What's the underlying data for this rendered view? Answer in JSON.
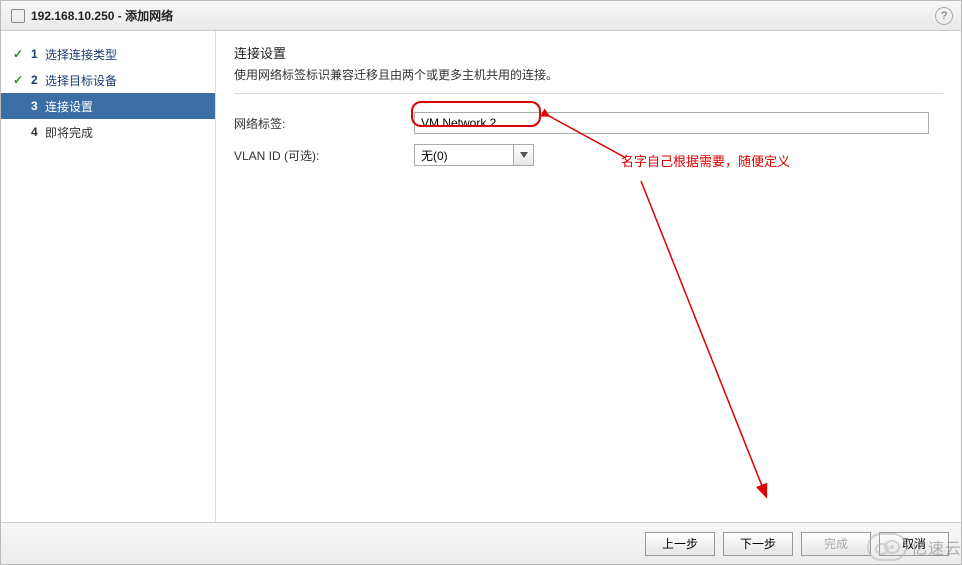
{
  "title": "192.168.10.250 - 添加网络",
  "help_symbol": "?",
  "steps": [
    {
      "num": "1",
      "label": "选择连接类型",
      "state": "done"
    },
    {
      "num": "2",
      "label": "选择目标设备",
      "state": "done"
    },
    {
      "num": "3",
      "label": "连接设置",
      "state": "active"
    },
    {
      "num": "4",
      "label": "即将完成",
      "state": "pending"
    }
  ],
  "section": {
    "title": "连接设置",
    "desc": "使用网络标签标识兼容迁移且由两个或更多主机共用的连接。"
  },
  "form": {
    "network_label": {
      "label": "网络标签:",
      "value": "VM Network 2"
    },
    "vlan": {
      "label": "VLAN ID (可选):",
      "selected": "无(0)"
    }
  },
  "annotation": {
    "text": "名字自己根据需要，随便定义"
  },
  "buttons": {
    "back": "上一步",
    "next": "下一步",
    "finish": "完成",
    "cancel": "取消"
  },
  "watermark": "亿速云"
}
